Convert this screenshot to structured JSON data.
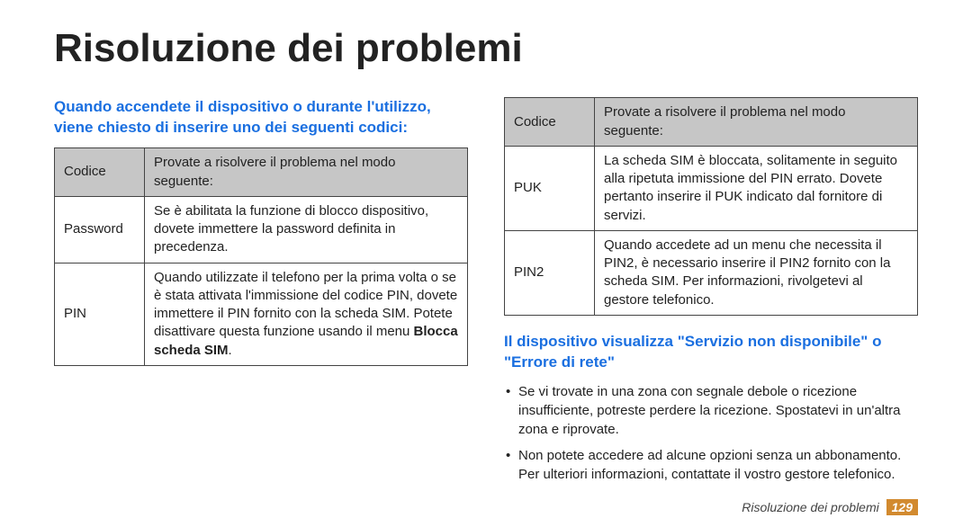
{
  "title": "Risoluzione dei problemi",
  "section1": {
    "heading": "Quando accendete il dispositivo o durante l'utilizzo, viene chiesto di inserire uno dei seguenti codici:",
    "table_header": {
      "col1": "Codice",
      "col2": "Provate a risolvere il problema nel modo seguente:"
    },
    "rows": {
      "r1": {
        "code": "Password",
        "text": "Se è abilitata la funzione di blocco dispositivo, dovete immettere la password definita in precedenza."
      },
      "r2": {
        "code": "PIN",
        "pre": "Quando utilizzate il telefono per la prima volta o se è stata attivata l'immissione del codice PIN, dovete immettere il PIN fornito con la scheda SIM. Potete disattivare questa funzione usando il menu ",
        "bold": "Blocca scheda SIM",
        "post": "."
      },
      "r3": {
        "code": "PUK",
        "text": "La scheda SIM è bloccata, solitamente in seguito alla ripetuta immissione del PIN errato. Dovete pertanto inserire il PUK indicato dal fornitore di servizi."
      },
      "r4": {
        "code": "PIN2",
        "text": "Quando accedete ad un menu che necessita il PIN2, è necessario inserire il PIN2 fornito con la scheda SIM. Per informazioni, rivolgetevi al gestore telefonico."
      }
    }
  },
  "section2": {
    "heading": "Il dispositivo visualizza \"Servizio non disponibile\" o \"Errore di rete\"",
    "bullets": {
      "b1": "Se vi trovate in una zona con segnale debole o ricezione insufficiente, potreste perdere la ricezione. Spostatevi in un'altra zona e riprovate.",
      "b2": "Non potete accedere ad alcune opzioni senza un abbonamento. Per ulteriori informazioni, contattate il vostro gestore telefonico."
    }
  },
  "footer": {
    "label": "Risoluzione dei problemi",
    "page": "129"
  }
}
